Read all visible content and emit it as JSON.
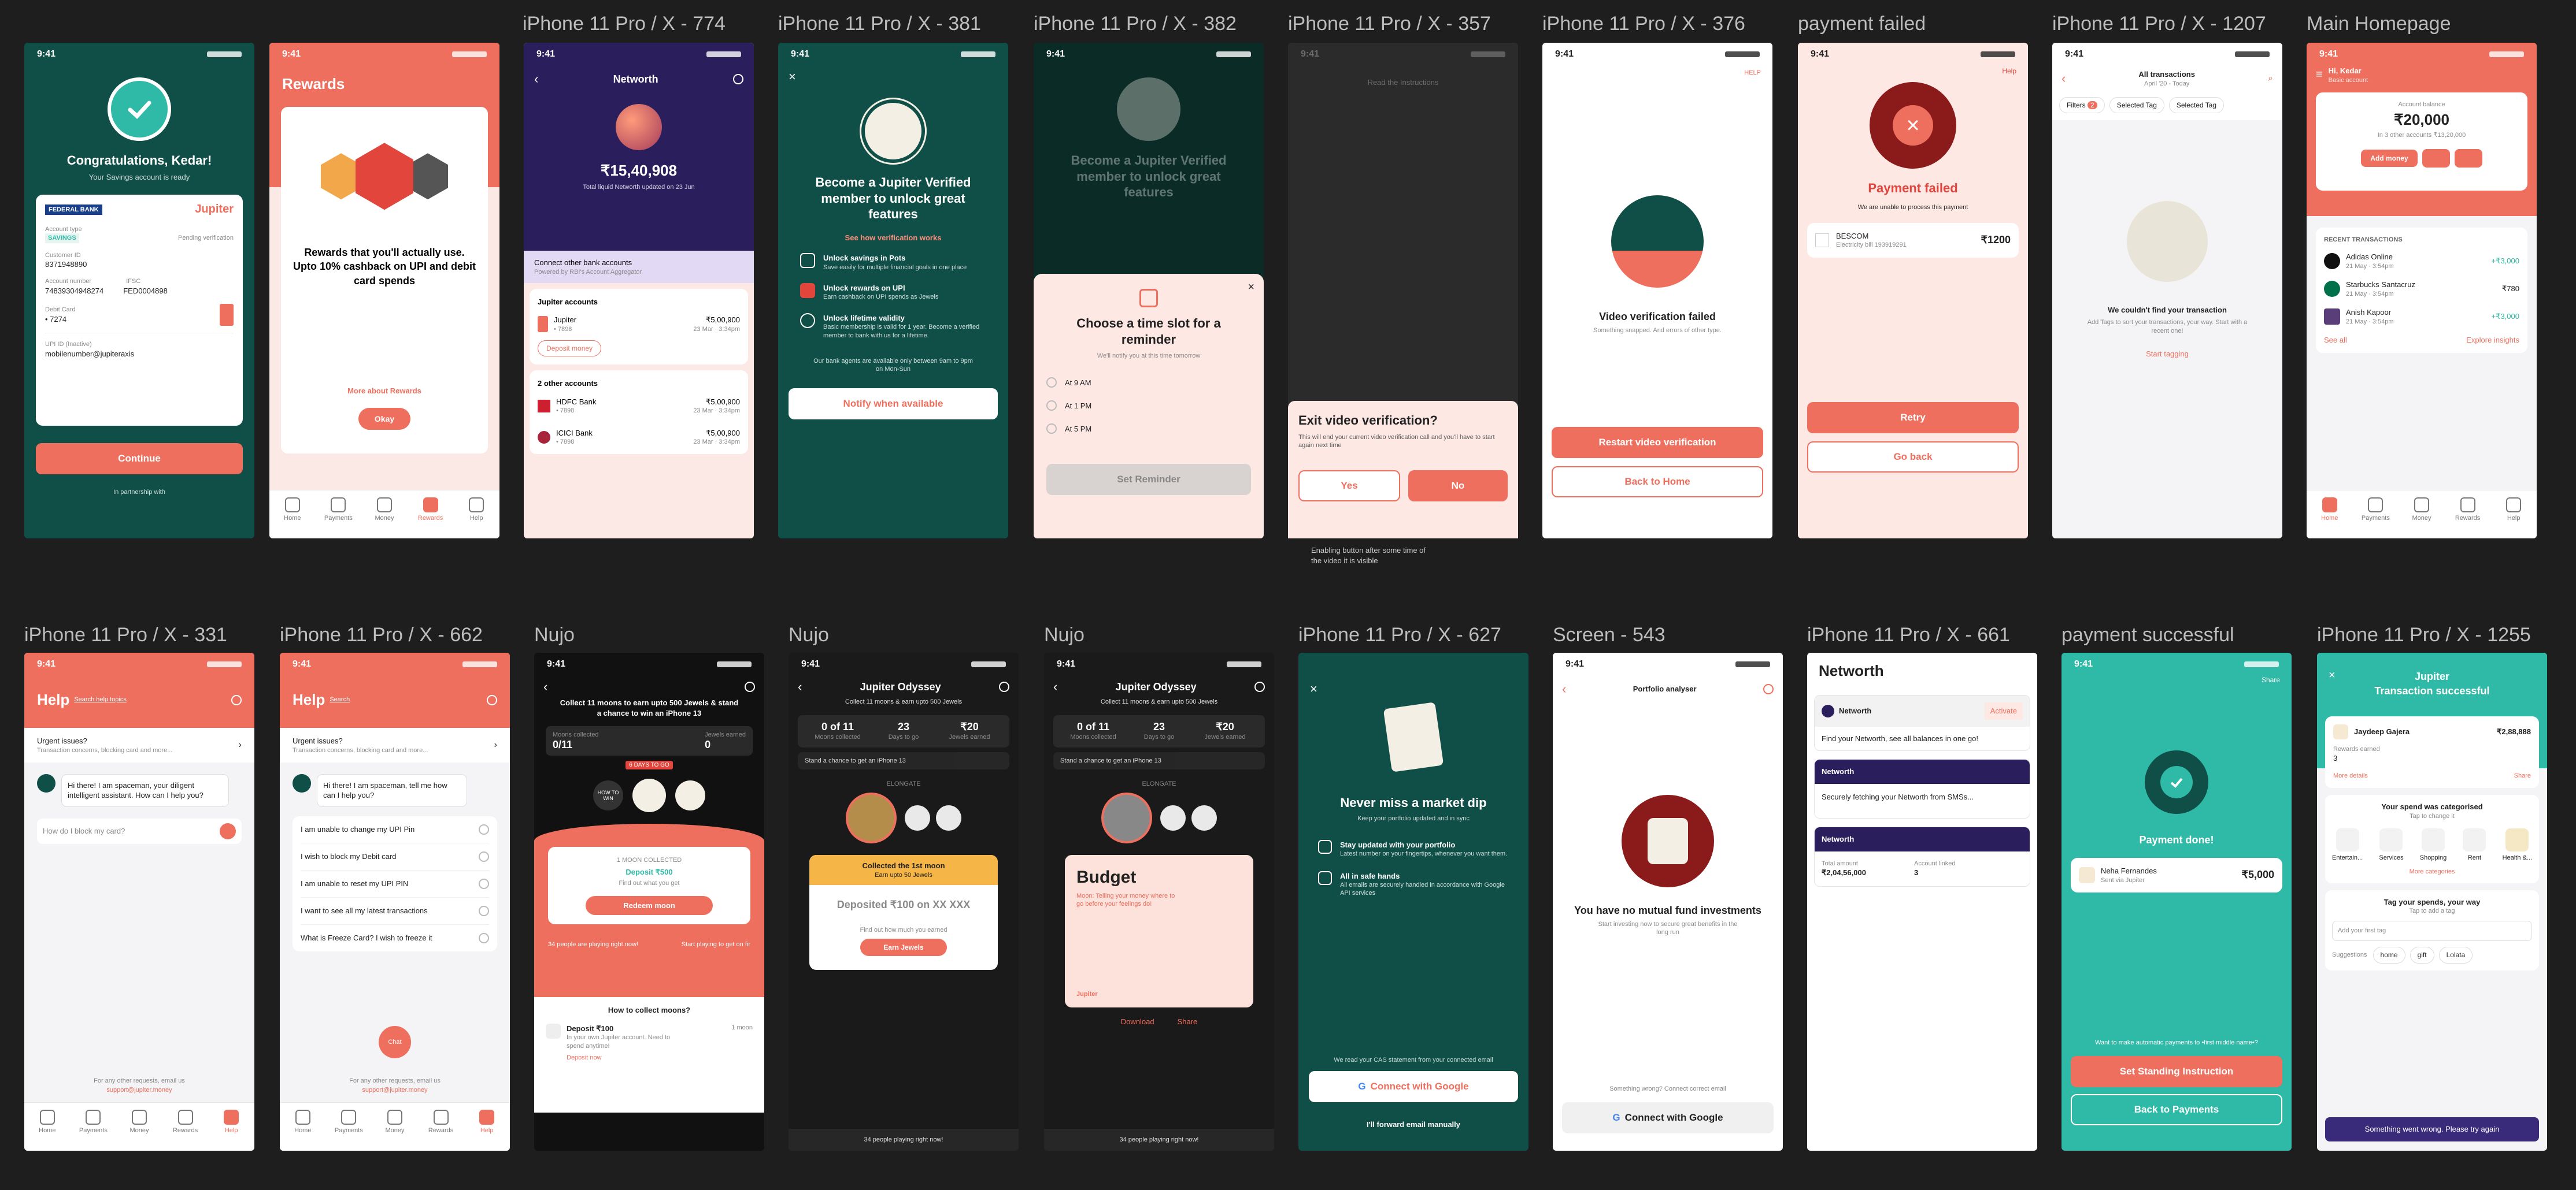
{
  "frame_labels": [
    "iPhone 11 Pro / X - 774",
    "iPhone 11 Pro / X - 381",
    "iPhone 11 Pro / X - 382",
    "iPhone 11 Pro / X - 357",
    "iPhone 11 Pro / X - 376",
    "payment failed",
    "iPhone 11 Pro / X - 1207",
    "Main Homepage",
    "iPhone 11 Pro / X - 331",
    "iPhone 11 Pro / X - 662",
    "Nujo",
    "Nujo",
    "Nujo",
    "iPhone 11 Pro / X - 627",
    "Screen - 543",
    "iPhone 11 Pro / X - 661",
    "payment successful",
    "iPhone 11 Pro / X - 1255"
  ],
  "time": "9:41",
  "tabs": {
    "home": "Home",
    "payments": "Payments",
    "money": "Money",
    "rewards": "Rewards",
    "help": "Help"
  },
  "s1": {
    "title": "Congratulations, Kedar!",
    "subtitle": "Your Savings account is ready",
    "bank": "FEDERAL BANK",
    "brand": "Jupiter",
    "acct_type_label": "Account type",
    "acct_type": "SAVINGS",
    "acct_status": "Pending verification",
    "cust_label": "Customer ID",
    "cust": "8371948890",
    "acct_no_label": "Account number",
    "acct_no": "74839304948274",
    "ifsc_label": "IFSC",
    "ifsc": "FED0004898",
    "debit_label": "Debit Card",
    "debit": "• 7274",
    "upi_label": "UPI ID (Inactive)",
    "upi": "mobilenumber@jupiteraxis",
    "continue": "Continue",
    "partner": "In partnership with"
  },
  "s2": {
    "title": "Rewards",
    "blurb": "Rewards that you'll actually use. Upto 10% cashback on UPI and debit card spends",
    "more": "More about Rewards",
    "okay": "Okay"
  },
  "s3": {
    "title": "Networth",
    "amount": "₹15,40,908",
    "updated": "Total liquid Networth updated on 23 Jun",
    "connect": "Connect other bank accounts",
    "connect_sub": "Powered by RBI's Account Aggregator",
    "jupiter_section": "Jupiter accounts",
    "jupiter": "Jupiter",
    "jupiter_no": "• 7898",
    "jupiter_amt": "₹5,00,900",
    "jupiter_time": "23 Mar · 3:34pm",
    "deposit": "Deposit money",
    "other_section": "2 other accounts",
    "hdfc": "HDFC Bank",
    "hdfc_no": "• 7898",
    "hdfc_amt": "₹5,00,900",
    "hdfc_time": "23 Mar · 3:34pm",
    "icici": "ICICI Bank",
    "icici_no": "• 7898",
    "icici_amt": "₹5,00,900",
    "icici_time": "23 Mar · 3:34pm"
  },
  "s4": {
    "title": "Become a Jupiter Verified member to unlock great features",
    "link": "See how verification works",
    "f1_t": "Unlock savings in Pots",
    "f1_d": "Save easily for multiple financial goals in one place",
    "f2_t": "Unlock rewards on UPI",
    "f2_d": "Earn cashback on UPI spends as Jewels",
    "f3_t": "Unlock lifetime validity",
    "f3_d": "Basic membership is valid for 1 year. Become a verified member to bank with us for a lifetime.",
    "agents": "Our bank agents are available only between 9am to 9pm on Mon-Sun",
    "notify": "Notify when available"
  },
  "s5": {
    "bg_title": "Become a Jupiter Verified member to unlock great features",
    "title": "Choose a time slot for a reminder",
    "sub": "We'll notify you at this time tomorrow",
    "o1": "At 9 AM",
    "o2": "At 1 PM",
    "o3": "At 5 PM",
    "set": "Set Reminder"
  },
  "s6": {
    "bg1": "Read the Instructions",
    "title": "Exit video verification?",
    "body": "This will end your current video verification call and you'll have to start again next time",
    "yes": "Yes",
    "no": "No",
    "note": "Enabling button after some time of the video it is visible"
  },
  "s7": {
    "help": "HELP",
    "title": "Video verification failed",
    "sub": "Something snapped. And errors of other type.",
    "restart": "Restart video verification",
    "back": "Back to Home"
  },
  "s8": {
    "help": "Help",
    "title": "Payment failed",
    "sub": "We are unable to process this payment",
    "payee": "BESCOM",
    "payee_sub": "Electricity bill 193919291",
    "amount": "₹1200",
    "retry": "Retry",
    "goback": "Go back"
  },
  "s9": {
    "title": "All transactions",
    "sub": "April '20 - Today",
    "filters": "Filters",
    "filter_count": "2",
    "tag1": "Selected Tag",
    "tag2": "Selected Tag",
    "empty_title": "We couldn't find your transaction",
    "empty_sub": "Add Tags to sort your transactions, your way. Start with a recent one!",
    "start": "Start tagging"
  },
  "s10": {
    "greet": "Hi, Kedar",
    "greet_sub": "Basic account",
    "balance_label": "Account balance",
    "balance": "₹20,000",
    "other": "In 3 other accounts ₹13,20,000",
    "add": "Add money",
    "recent": "RECENT TRANSACTIONS",
    "t1": "Adidas Online",
    "t1_d": "21 May · 3:54pm",
    "t1_a": "+₹3,000",
    "t2": "Starbucks Santacruz",
    "t2_d": "21 May · 3:54pm",
    "t2_a": "₹780",
    "t3": "Anish Kapoor",
    "t3_d": "21 May · 3:54pm",
    "t3_a": "+₹3,000",
    "see_all": "See all",
    "insights": "Explore insights"
  },
  "s11": {
    "title": "Help",
    "sub": "Search help topics",
    "urgent": "Urgent issues?",
    "urgent_sub": "Transaction concerns, blocking card and more...",
    "bot": "Hi there! I am spaceman, your diligent intelligent assistant. How can I help you?",
    "placeholder": "How do I block my card?",
    "footer": "For any other requests, email us",
    "email": "support@jupiter.money"
  },
  "s12": {
    "title": "Help",
    "sub": "Search",
    "urgent": "Urgent issues?",
    "urgent_sub": "Transaction concerns, blocking card and more...",
    "bot": "Hi there! I am spaceman, tell me how can I help you?",
    "q1": "I am unable to change my UPI Pin",
    "q2": "I wish to block my Debit card",
    "q3": "I am unable to reset my UPI PIN",
    "q4": "I want to see all my latest transactions",
    "q5": "What is Freeze Card? I wish to freeze it",
    "footer": "For any other requests, email us",
    "email": "support@jupiter.money",
    "chat": "Chat"
  },
  "s13": {
    "title": "Collect 11 moons to earn upto 500 Jewels & stand a chance to win an iPhone 13",
    "moons_label": "Moons collected",
    "moons": "0/11",
    "jewels_label": "Jewels earned",
    "jewels": "0",
    "days": "6 DAYS TO GO",
    "how": "HOW TO WIN",
    "card_t": "1 MOON COLLECTED",
    "card_s": "Deposit ₹500",
    "card_link": "Find out what you get",
    "redeem": "Redeem moon",
    "playing": "34 people are playing right now!",
    "start": "Start playing to get on fir",
    "collect": "How to collect moons?",
    "step": "Deposit ₹100",
    "step_sub": "In your own Jupiter account. Need to spend anytime!",
    "step_time": "1 moon",
    "deposit_now": "Deposit now"
  },
  "s14": {
    "title": "Jupiter Odyssey",
    "sub": "Collect 11 moons & earn upto 500 Jewels",
    "s1": "0 of 11",
    "s1_l": "Moons collected",
    "s2": "23",
    "s2_l": "Days to go",
    "s3": "₹20",
    "s3_l": "Jewels earned",
    "banner": "Stand a chance to get an iPhone 13",
    "moon_label": "ELONGATE",
    "card_t": "Collected the 1st moon",
    "card_s": "Earn upto 50 Jewels",
    "card_body": "Deposited ₹100 on XX XXX",
    "card_link": "Find out how much you earned",
    "earn": "Earn Jewels",
    "playing": "34 people playing right now!"
  },
  "s15": {
    "title": "Jupiter Odyssey",
    "sub": "Collect 11 moons & earn upto 500 Jewels",
    "s1": "0 of 11",
    "s1_l": "Moons collected",
    "s2": "23",
    "s2_l": "Days to go",
    "s3": "₹20",
    "s3_l": "Jewels earned",
    "banner": "Stand a chance to get an iPhone 13",
    "moon_label": "ELONGATE",
    "budget": "Budget",
    "budget_sub": "Moon: Telling your money where to go before your feelings do!",
    "brand": "Jupiter",
    "download": "Download",
    "share": "Share",
    "playing": "34 people playing right now!"
  },
  "s16": {
    "title": "Never miss a market dip",
    "sub": "Keep your portfolio updated and in sync",
    "f1_t": "Stay updated with your portfolio",
    "f1_d": "Latest number on your fingertips, whenever you want them.",
    "f2_t": "All in safe hands",
    "f2_d": "All emails are securely handled in accordance with Google API services",
    "note": "We read your CAS statement from your connected email",
    "google": "Connect with Google",
    "manual": "I'll forward email manually"
  },
  "s17": {
    "title": "Portfolio analyser",
    "empty_t": "You have no mutual fund investments",
    "empty_s": "Start investing now to secure great benefits in the long run",
    "wrong": "Something wrong? Connect correct email",
    "google": "Connect with Google"
  },
  "s18": {
    "title": "Networth",
    "nw": "Networth",
    "activate": "Activate",
    "find": "Find your Networth, see all balances in one go!",
    "nw2": "Networth",
    "fetching": "Securely fetching your Networth from SMSs...",
    "nw3": "Networth",
    "total_l": "Total amount",
    "total": "₹2,04,56,000",
    "linked_l": "Account linked",
    "linked": "3"
  },
  "s19": {
    "share": "Share",
    "title": "Payment done!",
    "payee": "Neha Fernandes",
    "payee_sub": "Sent via Jupiter",
    "amount": "₹5,000",
    "question": "Want to make automatic payments to •first middle name•?",
    "standing": "Set Standing Instruction",
    "back": "Back to Payments"
  },
  "s20": {
    "brand": "Jupiter",
    "title": "Transaction successful",
    "payee": "Jaydeep Gajera",
    "amount": "₹2,88,888",
    "rewards_l": "Rewards earned",
    "rewards": "3",
    "more": "More details",
    "share": "Share",
    "cat_t": "Your spend was categorised",
    "cat_s": "Tap to change it",
    "c1": "Entertain...",
    "c2": "Services",
    "c3": "Shopping",
    "c4": "Rent",
    "c5": "Health &...",
    "more_cat": "More categories",
    "tag_t": "Tag your spends, your way",
    "tag_s": "Tap to add a tag",
    "tag_ph": "Add your first tag",
    "sugg": "Suggestions",
    "g1": "home",
    "g2": "gift",
    "g3": "Lolata",
    "error": "Something went wrong. Please try again"
  },
  "colors": {
    "coral": "#ef6f5e",
    "teal": "#0f4f47",
    "green": "#2fb9a7",
    "dark": "#121212"
  }
}
